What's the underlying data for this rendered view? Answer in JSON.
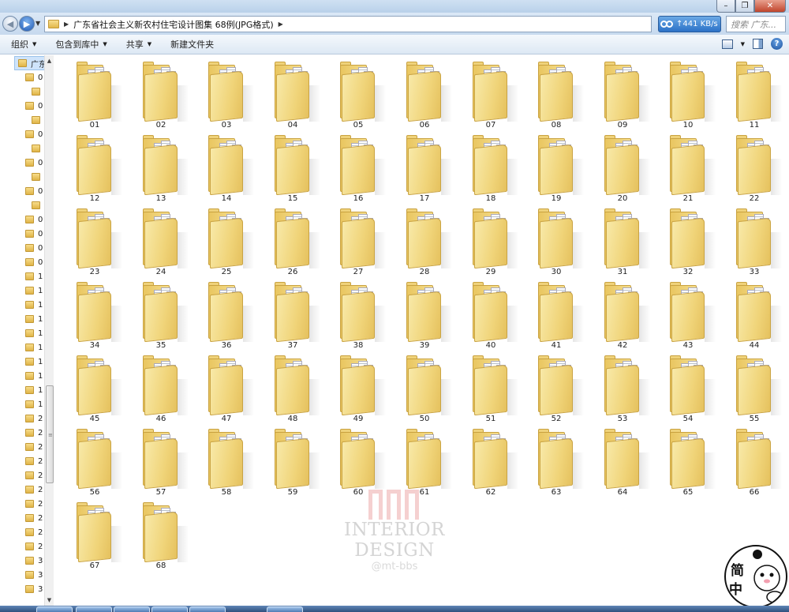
{
  "window": {
    "title_buttons": [
      "–",
      "❐",
      "✕"
    ]
  },
  "address": {
    "path": "广东省社会主义新农村住宅设计图集 68例(JPG格式)",
    "speed": "441 KB/s",
    "search_placeholder": "搜索 广东..."
  },
  "toolbar": {
    "organize": "组织",
    "include_library": "包含到库中",
    "share": "共享",
    "new_folder": "新建文件夹"
  },
  "tree": {
    "items": [
      "广东",
      "0",
      "",
      "0",
      "",
      "0",
      "",
      "0",
      "",
      "0",
      "",
      "0",
      "0",
      "0",
      "0",
      "1",
      "1",
      "1",
      "1",
      "1",
      "1",
      "1",
      "1",
      "1",
      "1",
      "2",
      "2",
      "2",
      "2",
      "2",
      "2",
      "2",
      "2",
      "2",
      "2",
      "3",
      "3",
      "3"
    ]
  },
  "folders": [
    "01",
    "02",
    "03",
    "04",
    "05",
    "06",
    "07",
    "08",
    "09",
    "10",
    "11",
    "12",
    "13",
    "14",
    "15",
    "16",
    "17",
    "18",
    "19",
    "20",
    "21",
    "22",
    "23",
    "24",
    "25",
    "26",
    "27",
    "28",
    "29",
    "30",
    "31",
    "32",
    "33",
    "34",
    "35",
    "36",
    "37",
    "38",
    "39",
    "40",
    "41",
    "42",
    "43",
    "44",
    "45",
    "46",
    "47",
    "48",
    "49",
    "50",
    "51",
    "52",
    "53",
    "54",
    "55",
    "56",
    "57",
    "58",
    "59",
    "60",
    "61",
    "62",
    "63",
    "64",
    "65",
    "66",
    "67",
    "68"
  ],
  "watermark": {
    "text": "INTERIOR DESIGN",
    "sub": "@mt-bbs"
  },
  "stamp": {
    "chars": [
      "简",
      "中"
    ]
  },
  "colors": {
    "chrome": "#c6d9ee",
    "folder": "#f0d479",
    "selection": "#cfe4fb"
  }
}
